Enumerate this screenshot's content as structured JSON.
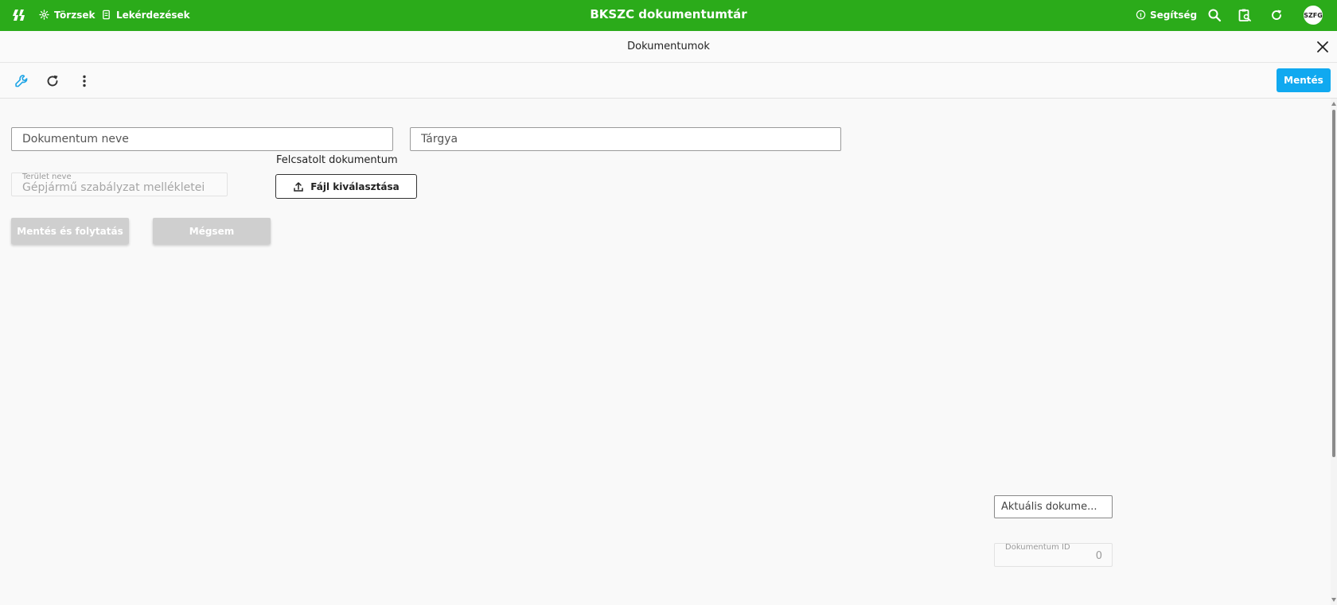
{
  "topbar": {
    "nav": [
      {
        "label": "Törzsek",
        "icon": "gear-icon"
      },
      {
        "label": "Lekérdezések",
        "icon": "document-icon"
      }
    ],
    "title": "BKSZC dokumentumtár",
    "help_label": "Segítség",
    "avatar_initials": "SZFG",
    "background_color": "#2bab1a"
  },
  "header": {
    "title": "Dokumentumok"
  },
  "toolbar": {
    "save_label": "Mentés",
    "save_color": "#10a9f0",
    "icons": [
      "wrench-icon",
      "refresh-icon",
      "more-vert-icon"
    ]
  },
  "form": {
    "document_name_placeholder": "Dokumentum neve",
    "subject_placeholder": "Tárgya",
    "area_label": "Terület neve",
    "area_value": "Gépjármű szabályzat mellékletei",
    "upload_label": "Felcsatolt dokumentum",
    "upload_button": "Fájl kiválasztása",
    "save_continue_label": "Mentés és folytatás",
    "cancel_label": "Mégsem",
    "current_doc_label": "Aktuális dokume...",
    "doc_id_label": "Dokumentum ID",
    "doc_id_value": "0"
  }
}
